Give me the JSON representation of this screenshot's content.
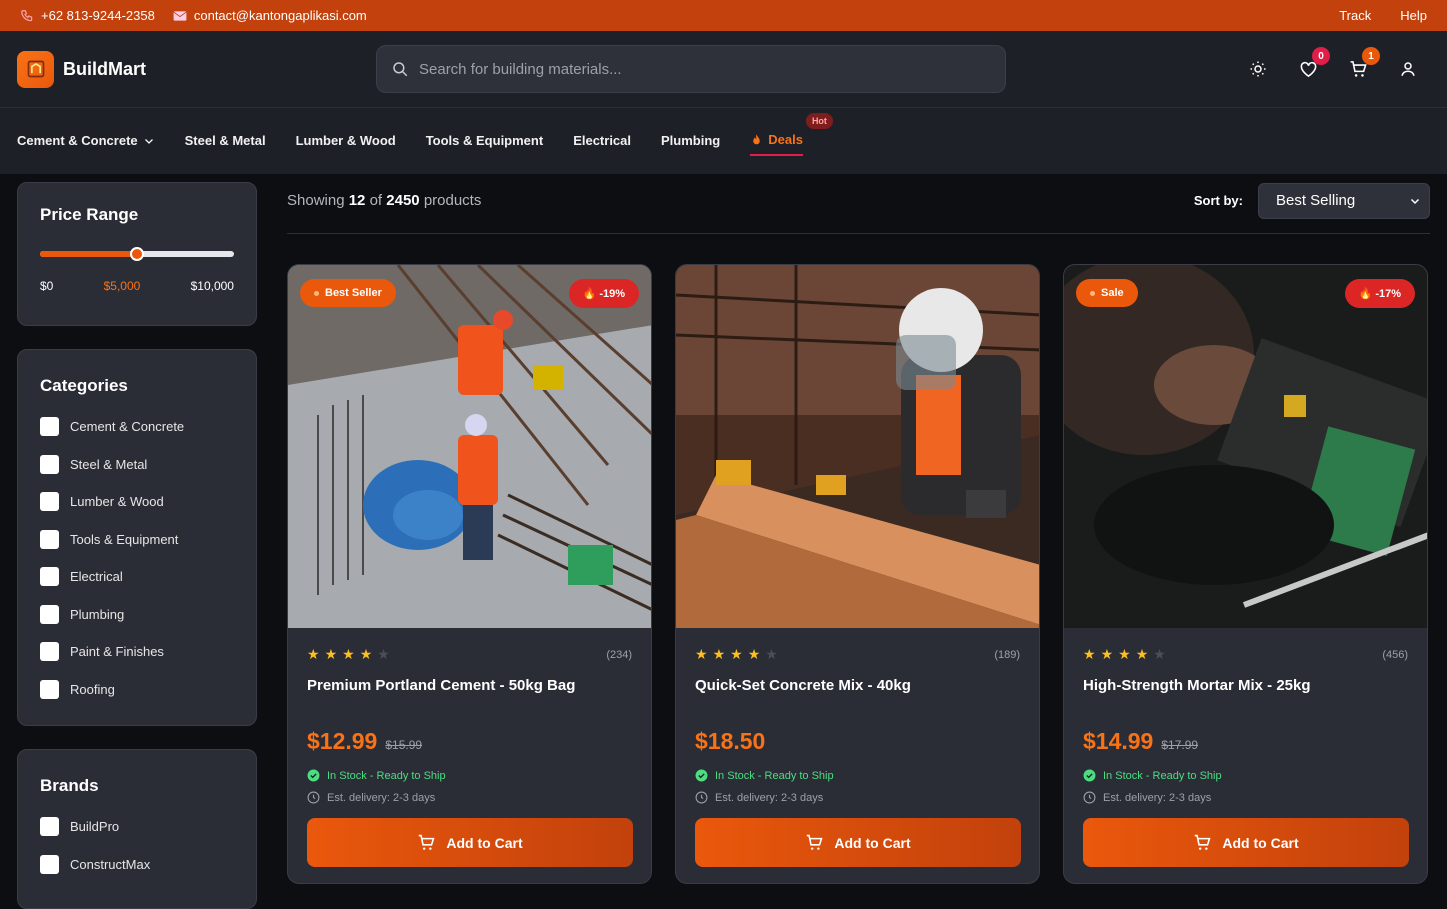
{
  "topbar": {
    "phone": "+62 813-9244-2358",
    "email": "contact@kantongaplikasi.com",
    "links": [
      "Track",
      "Help"
    ]
  },
  "brand": {
    "name": "BuildMart"
  },
  "search": {
    "placeholder": "Search for building materials..."
  },
  "header_icons": {
    "wishlist_count": "0",
    "cart_count": "1"
  },
  "nav": {
    "items": [
      "Cement & Concrete",
      "Steel & Metal",
      "Lumber & Wood",
      "Tools & Equipment",
      "Electrical",
      "Plumbing",
      "Deals"
    ],
    "deals_badge": "Hot"
  },
  "price_range": {
    "title": "Price Range",
    "min": "$0",
    "current": "$5,000",
    "max": "$10,000",
    "fraction": 0.5
  },
  "categories": {
    "title": "Categories",
    "items": [
      "Cement & Concrete",
      "Steel & Metal",
      "Lumber & Wood",
      "Tools & Equipment",
      "Electrical",
      "Plumbing",
      "Paint & Finishes",
      "Roofing"
    ]
  },
  "brands": {
    "title": "Brands",
    "items": [
      "BuildPro",
      "ConstructMax"
    ]
  },
  "results": {
    "showing_prefix": "Showing",
    "shown": "12",
    "of": "of",
    "total": "2450",
    "suffix": "products"
  },
  "sort": {
    "label": "Sort by:",
    "value": "Best Selling"
  },
  "products": [
    {
      "tag": "Best Seller",
      "discount": "-19%",
      "rating": 4,
      "reviews": "(234)",
      "name": "Premium Portland Cement - 50kg Bag",
      "price": "$12.99",
      "old_price": "$15.99",
      "stock": "In Stock - Ready to Ship",
      "delivery": "Est. delivery: 2-3 days",
      "button": "Add to Cart"
    },
    {
      "tag": "",
      "discount": "",
      "rating": 4,
      "reviews": "(189)",
      "name": "Quick-Set Concrete Mix - 40kg",
      "price": "$18.50",
      "old_price": "",
      "stock": "In Stock - Ready to Ship",
      "delivery": "Est. delivery: 2-3 days",
      "button": "Add to Cart"
    },
    {
      "tag": "Sale",
      "discount": "-17%",
      "rating": 4,
      "reviews": "(456)",
      "name": "High-Strength Mortar Mix - 25kg",
      "price": "$14.99",
      "old_price": "$17.99",
      "stock": "In Stock - Ready to Ship",
      "delivery": "Est. delivery: 2-3 days",
      "button": "Add to Cart"
    }
  ],
  "colors": {
    "accent": "#ea580c",
    "topbar": "#c2410c",
    "stock": "#4ade80",
    "discount": "#dc2626"
  }
}
